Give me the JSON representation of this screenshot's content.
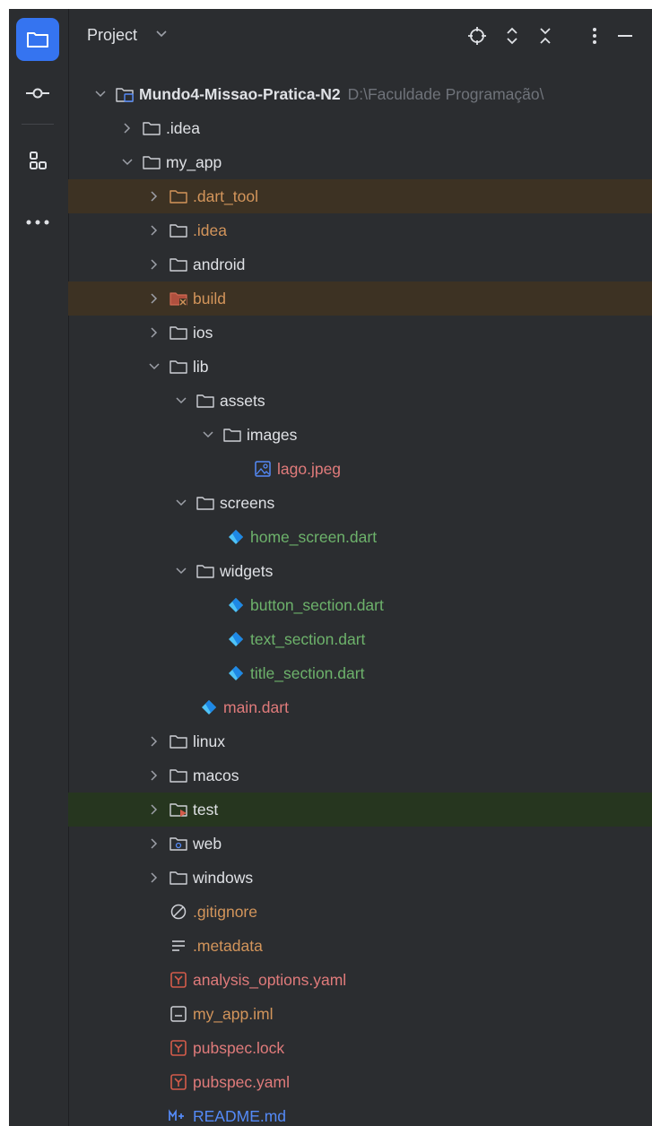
{
  "panel": {
    "title": "Project"
  },
  "tree": {
    "root": {
      "name": "Mundo4-Missao-Pratica-N2",
      "path": "D:\\Faculdade Programação\\"
    },
    "items": [
      {
        "label": ".idea"
      },
      {
        "label": "my_app"
      },
      {
        "label": ".dart_tool"
      },
      {
        "label": ".idea"
      },
      {
        "label": "android"
      },
      {
        "label": "build"
      },
      {
        "label": "ios"
      },
      {
        "label": "lib"
      },
      {
        "label": "assets"
      },
      {
        "label": "images"
      },
      {
        "label": "lago.jpeg"
      },
      {
        "label": "screens"
      },
      {
        "label": "home_screen.dart"
      },
      {
        "label": "widgets"
      },
      {
        "label": "button_section.dart"
      },
      {
        "label": "text_section.dart"
      },
      {
        "label": "title_section.dart"
      },
      {
        "label": "main.dart"
      },
      {
        "label": "linux"
      },
      {
        "label": "macos"
      },
      {
        "label": "test"
      },
      {
        "label": "web"
      },
      {
        "label": "windows"
      },
      {
        "label": ".gitignore"
      },
      {
        "label": ".metadata"
      },
      {
        "label": "analysis_options.yaml"
      },
      {
        "label": "my_app.iml"
      },
      {
        "label": "pubspec.lock"
      },
      {
        "label": "pubspec.yaml"
      },
      {
        "label": "README.md"
      }
    ]
  },
  "colors": {
    "background": "#2b2d30",
    "accent": "#3574f0",
    "ignored_row": "#3d3223",
    "test_row": "#26361f",
    "ignored_text": "#d3955b",
    "added_text": "#6db26b",
    "modified_text": "#e07b7b"
  }
}
